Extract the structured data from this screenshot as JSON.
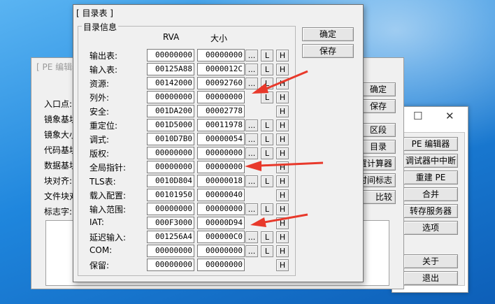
{
  "bg_window_peeditor": {
    "title": "[ PE 编辑器",
    "labels": [
      "入口点:",
      "镜象基址",
      "镜象大小",
      "代码基址",
      "数据基址",
      "块对齐:",
      "文件块对",
      "标志字:"
    ],
    "buttons": [
      "确定",
      "保存",
      "区段",
      "目录",
      "位置计算器",
      "时间标志",
      "比较"
    ]
  },
  "bg_window_main": {
    "controls": {
      "maximize": "☐",
      "close": "✕"
    },
    "buttons": [
      "PE 编辑器",
      "调试器中中断",
      "重建 PE",
      "合并",
      "转存服务器",
      "选项",
      "关于",
      "退出"
    ]
  },
  "dialog": {
    "title": "[ 目录表 ]",
    "group_title": "目录信息",
    "col_rva": "RVA",
    "col_size": "大小",
    "ok_button": "确定",
    "save_button": "保存",
    "rows": [
      {
        "label": "输出表:",
        "rva": "00000000",
        "size": "00000000",
        "dots": true,
        "L": true,
        "H": true
      },
      {
        "label": "输入表:",
        "rva": "00125A88",
        "size": "0000012C",
        "dots": true,
        "L": true,
        "H": true
      },
      {
        "label": "资源:",
        "rva": "00142000",
        "size": "00092760",
        "dots": true,
        "L": true,
        "H": true
      },
      {
        "label": "列外:",
        "rva": "00000000",
        "size": "00000000",
        "dots": false,
        "L": true,
        "H": true
      },
      {
        "label": "安全:",
        "rva": "001DA200",
        "size": "00002778",
        "dots": false,
        "L": false,
        "H": true
      },
      {
        "label": "重定位:",
        "rva": "001D5000",
        "size": "00011978",
        "dots": true,
        "L": true,
        "H": true
      },
      {
        "label": "调式:",
        "rva": "0010D7B0",
        "size": "00000054",
        "dots": true,
        "L": true,
        "H": true
      },
      {
        "label": "版权:",
        "rva": "00000000",
        "size": "00000000",
        "dots": true,
        "L": true,
        "H": true
      },
      {
        "label": "全局指针:",
        "rva": "00000000",
        "size": "00000000",
        "dots": false,
        "L": false,
        "H": true
      },
      {
        "label": "TLS表:",
        "rva": "0010D804",
        "size": "00000018",
        "dots": true,
        "L": true,
        "H": true
      },
      {
        "label": "载入配置:",
        "rva": "00101950",
        "size": "00000040",
        "dots": false,
        "L": false,
        "H": true
      },
      {
        "label": "输入范围:",
        "rva": "00000000",
        "size": "00000000",
        "dots": true,
        "L": true,
        "H": true
      },
      {
        "label": "IAT:",
        "rva": "000F3000",
        "size": "00000D94",
        "dots": false,
        "L": false,
        "H": true
      },
      {
        "label": "延迟输入:",
        "rva": "001256A4",
        "size": "000000C0",
        "dots": true,
        "L": true,
        "H": true
      },
      {
        "label": "COM:",
        "rva": "00000000",
        "size": "00000000",
        "dots": true,
        "L": true,
        "H": true
      },
      {
        "label": "保留:",
        "rva": "00000000",
        "size": "00000000",
        "dots": false,
        "L": false,
        "H": true
      }
    ],
    "small_buttons": {
      "dots": "...",
      "L": "L",
      "H": "H"
    }
  },
  "annotations": {
    "arrow_color": "#e8392b"
  },
  "icons": [
    "maximize-icon",
    "close-icon",
    "red-arrow-annotation"
  ]
}
